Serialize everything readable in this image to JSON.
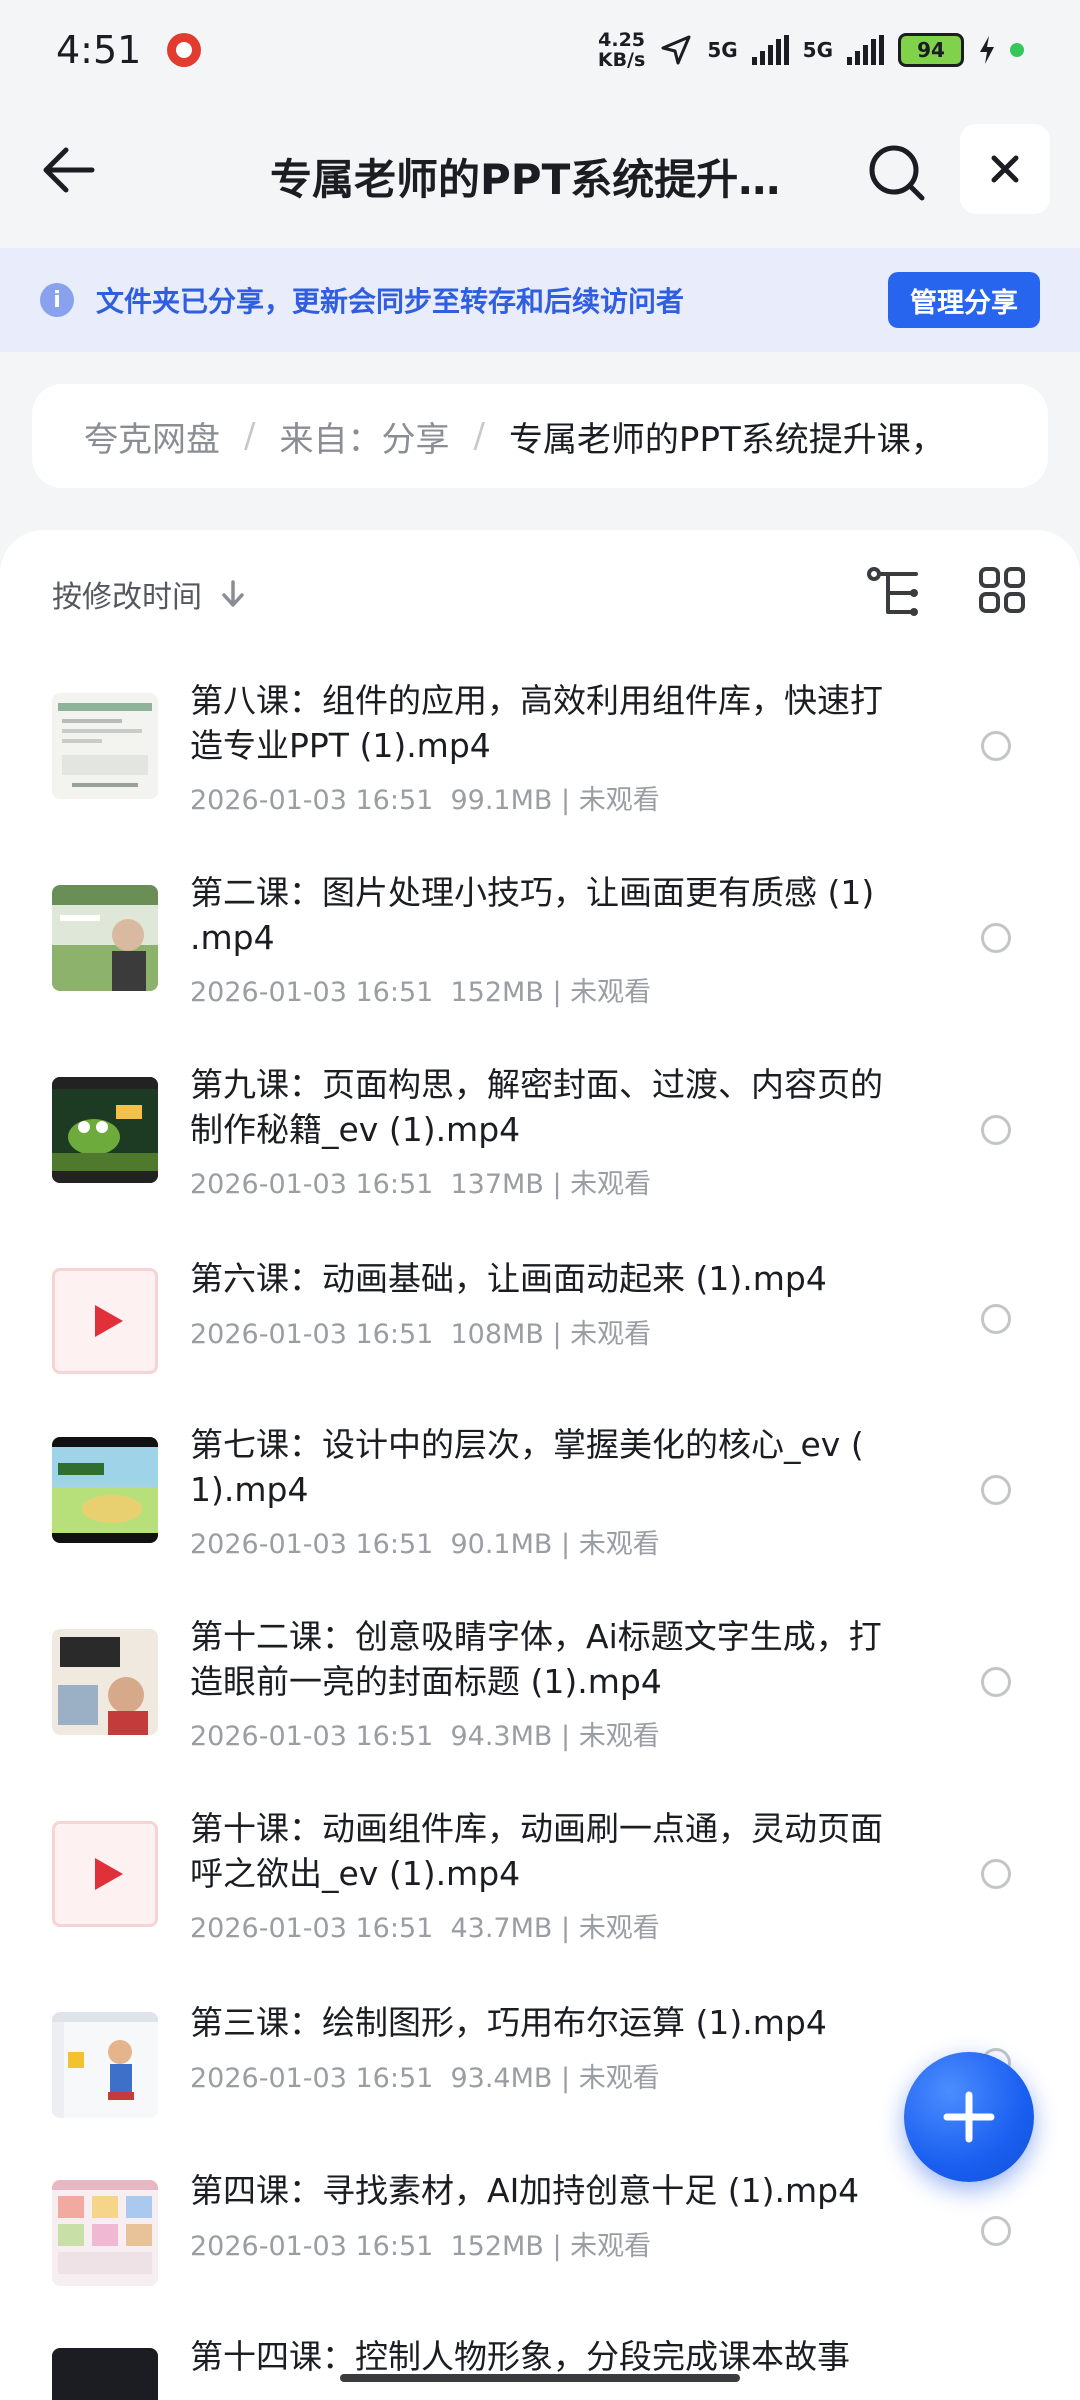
{
  "status_bar": {
    "time": "4:51",
    "net_speed_value": "4.25",
    "net_speed_unit": "KB/s",
    "signal_1": "5G",
    "signal_2": "5G",
    "battery": "94"
  },
  "header": {
    "title": "专属老师的PPT系统提升…"
  },
  "share_banner": {
    "text": "文件夹已分享，更新会同步至转存和后续访问者",
    "button": "管理分享"
  },
  "breadcrumb": {
    "items": [
      "夸克网盘",
      "来自：分享",
      "专属老师的PPT系统提升课，"
    ],
    "separator": "/"
  },
  "sort": {
    "label": "按修改时间"
  },
  "files": [
    {
      "title": "第八课：组件的应用，高效利用组件库，快速打造专业PPT (1).mp4",
      "date": "2026-01-03 16:51",
      "size": "99.1MB",
      "status": "未观看"
    },
    {
      "title": "第二课：图片处理小技巧，让画面更有质感 (1) .mp4",
      "date": "2026-01-03 16:51",
      "size": "152MB",
      "status": "未观看"
    },
    {
      "title": "第九课：页面构思，解密封面、过渡、内容页的制作秘籍_ev (1).mp4",
      "date": "2026-01-03 16:51",
      "size": "137MB",
      "status": "未观看"
    },
    {
      "title": "第六课：动画基础，让画面动起来 (1).mp4",
      "date": "2026-01-03 16:51",
      "size": "108MB",
      "status": "未观看"
    },
    {
      "title": "第七课：设计中的层次，掌握美化的核心_ev ( 1).mp4",
      "date": "2026-01-03 16:51",
      "size": "90.1MB",
      "status": "未观看"
    },
    {
      "title": "第十二课：创意吸睛字体，Ai标题文字生成，打造眼前一亮的封面标题 (1).mp4",
      "date": "2026-01-03 16:51",
      "size": "94.3MB",
      "status": "未观看"
    },
    {
      "title": "第十课：动画组件库，动画刷一点通，灵动页面呼之欲出_ev (1).mp4",
      "date": "2026-01-03 16:51",
      "size": "43.7MB",
      "status": "未观看"
    },
    {
      "title": "第三课：绘制图形，巧用布尔运算 (1).mp4",
      "date": "2026-01-03 16:51",
      "size": "93.4MB",
      "status": "未观看"
    },
    {
      "title": "第四课：寻找素材，AI加持创意十足 (1).mp4",
      "date": "2026-01-03 16:51",
      "size": "152MB",
      "status": "未观看"
    },
    {
      "title": "第十四课：控制人物形象，分段完成课本故事",
      "date": "",
      "size": "",
      "status": ""
    }
  ],
  "icons": {
    "back": "arrow-left-icon",
    "search": "search-icon",
    "close": "close-icon",
    "info": "info-icon",
    "sort_direction": "arrow-down-icon",
    "tree_view": "tree-view-icon",
    "grid_view": "grid-view-icon",
    "fab": "plus-icon"
  },
  "colors": {
    "accent": "#2865ee",
    "banner_bg": "#e8ecfb",
    "banner_text": "#2f5fe0",
    "play_icon": "#e0303a"
  }
}
